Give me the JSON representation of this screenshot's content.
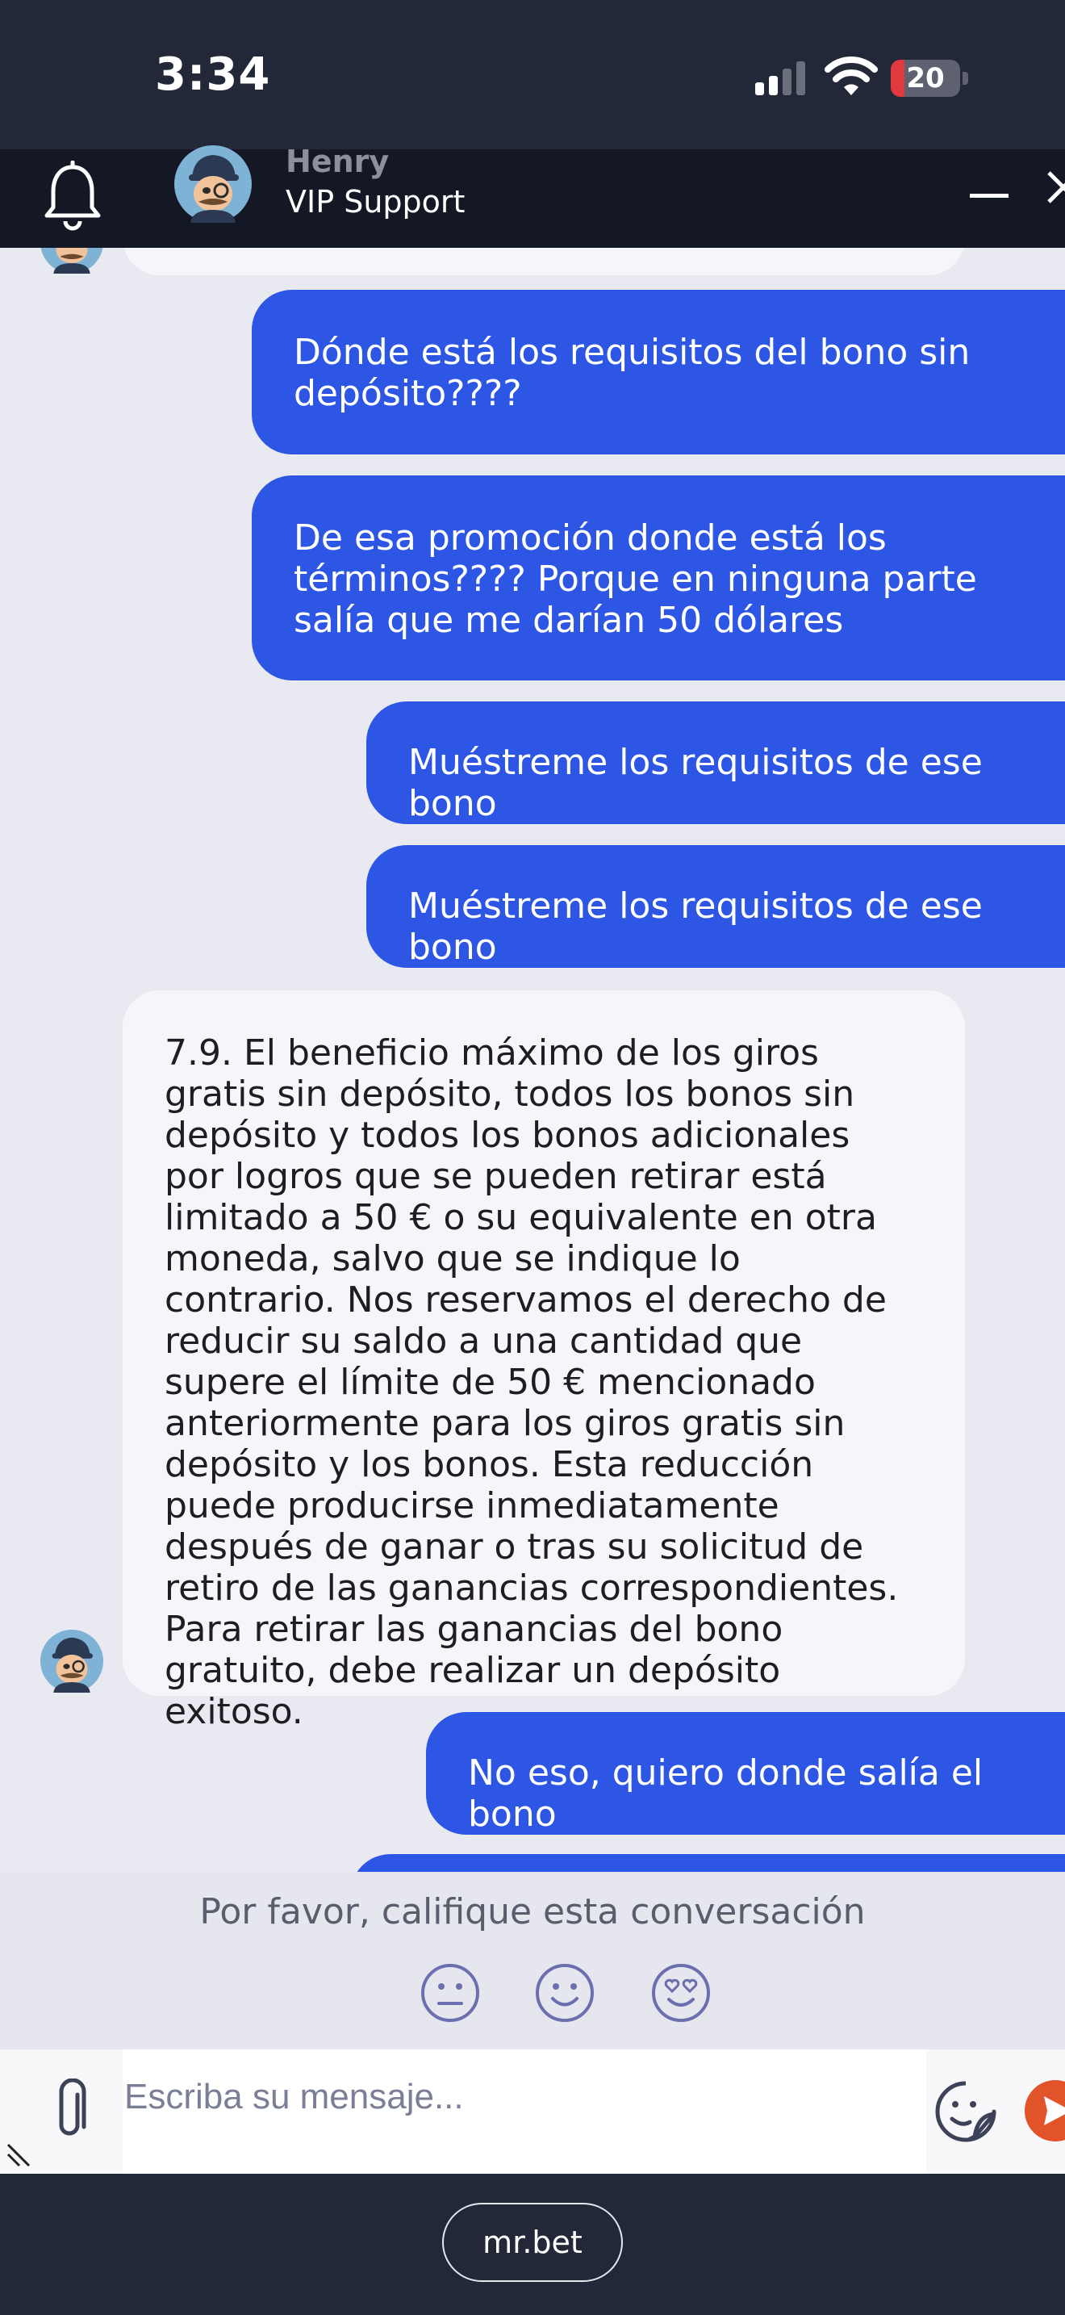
{
  "status_bar": {
    "time": "3:34",
    "battery_level": "20",
    "battery_fraction": 0.2,
    "battery_color": "#e0393e"
  },
  "header": {
    "agent_name": "Henry",
    "agent_role": "VIP Support"
  },
  "colors": {
    "user_bubble": "#2c56e3",
    "agent_bubble": "#f6f6fa",
    "chat_background": "#e9e9f1",
    "send_button": "#e2532a"
  },
  "messages": [
    {
      "from": "user",
      "text": "Dónde está los requisitos del bono sin depósito????"
    },
    {
      "from": "user",
      "text": "De esa promoción donde está los términos???? Porque en ninguna parte salía que me darían 50 dólares"
    },
    {
      "from": "user",
      "text": "Muéstreme los requisitos de ese bono"
    },
    {
      "from": "user",
      "text": "Muéstreme los requisitos de ese bono"
    },
    {
      "from": "agent",
      "text": "7.9. El beneficio máximo de los giros gratis sin depósito, todos los bonos sin depósito y todos los bonos adicionales por logros que se pueden retirar está limitado a 50 € o su equivalente en otra moneda, salvo que se indique lo contrario. Nos reservamos el derecho de reducir su saldo a una cantidad que supere el límite de 50 € mencionado anteriormente para los giros gratis sin depósito y los bonos. Esta reducción puede producirse inmediatamente después de ganar o tras su solicitud de retiro de las ganancias correspondientes. Para retirar las ganancias del bono gratuito, debe realizar un depósito exitoso."
    },
    {
      "from": "user",
      "text": "No eso, quiero donde salía el bono"
    }
  ],
  "rating": {
    "prompt": "Por favor, califique esta conversación",
    "options": [
      "neutral-face-icon",
      "smile-face-icon",
      "heart-eyes-face-icon"
    ]
  },
  "composer": {
    "placeholder": "Escriba su mensaje..."
  },
  "browser": {
    "url": "mr.bet"
  }
}
